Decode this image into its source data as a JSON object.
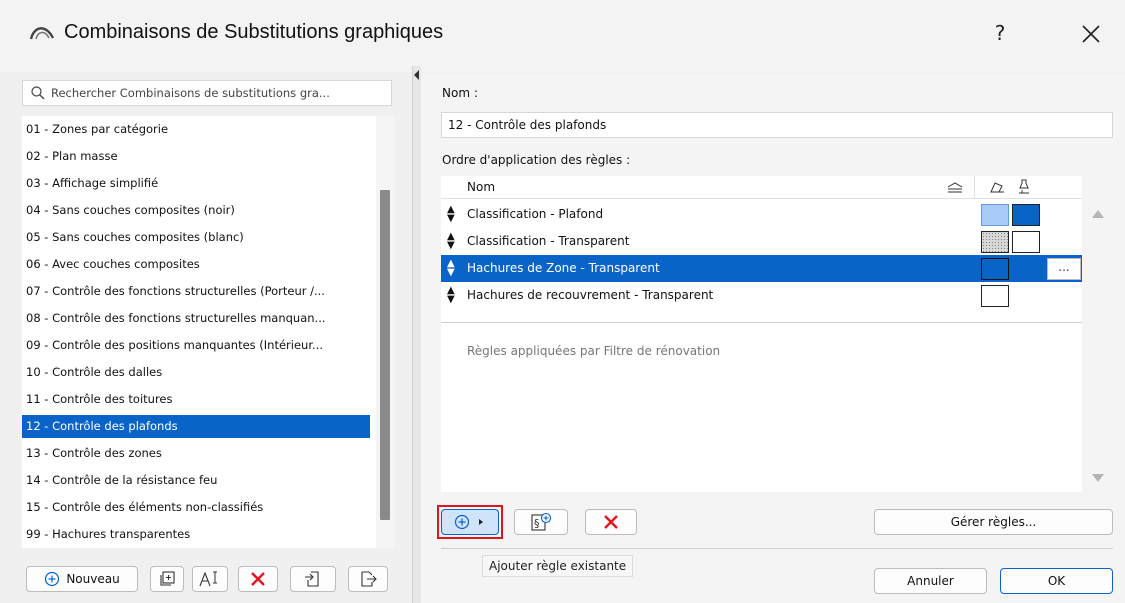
{
  "window": {
    "title": "Combinaisons de Substitutions graphiques",
    "help_label": "?",
    "close_label": "×"
  },
  "search": {
    "placeholder": "Rechercher Combinaisons de substitutions gra..."
  },
  "combinations": {
    "items": [
      "01 - Zones par catégorie",
      "02 - Plan masse",
      "03 - Affichage simplifié",
      "04 - Sans couches composites (noir)",
      "05 - Sans couches composites (blanc)",
      "06 - Avec couches composites",
      "07 - Contrôle des fonctions structurelles (Porteur /...",
      "08 - Contrôle des fonctions structurelles manquan...",
      "09 - Contrôle des positions manquantes (Intérieur...",
      "10 - Contrôle des dalles",
      "11 - Contrôle des toitures",
      "12 - Contrôle des plafonds",
      "13 - Contrôle des zones",
      "14 - Contrôle de la résistance feu",
      "15 - Contrôle des éléments non-classifiés",
      "99 - Hachures transparentes"
    ],
    "selected": "12 - Contrôle des plafonds"
  },
  "left_buttons": {
    "new_label": "Nouveau"
  },
  "details": {
    "name_label": "Nom :",
    "name_value": "12 - Contrôle des plafonds",
    "rules_label": "Ordre d'application des règles :",
    "column_name": "Nom",
    "rules": [
      {
        "name": "Classification - Plafond",
        "fill": "light-blue",
        "pen": "blue"
      },
      {
        "name": "Classification - Transparent",
        "fill": "dotted-gray",
        "pen": "white"
      },
      {
        "name": "Hachures de Zone - Transparent",
        "fill": "blue",
        "pen": "none",
        "selected": true,
        "more_label": "..."
      },
      {
        "name": "Hachures de recouvrement - Transparent",
        "fill": "white",
        "pen": "none"
      }
    ],
    "renovation_text": "Règles appliquées par Filtre de rénovation"
  },
  "rule_buttons": {
    "manage_label": "Gérer règles...",
    "tooltip": "Ajouter règle existante"
  },
  "footer": {
    "cancel_label": "Annuler",
    "ok_label": "OK"
  },
  "colors": {
    "selection": "#0a64c8",
    "swatch_blue": "#0a64c8",
    "swatch_light_blue": "#a8ccf5",
    "highlight_border": "#e0141e",
    "delete_red": "#e0141e"
  }
}
